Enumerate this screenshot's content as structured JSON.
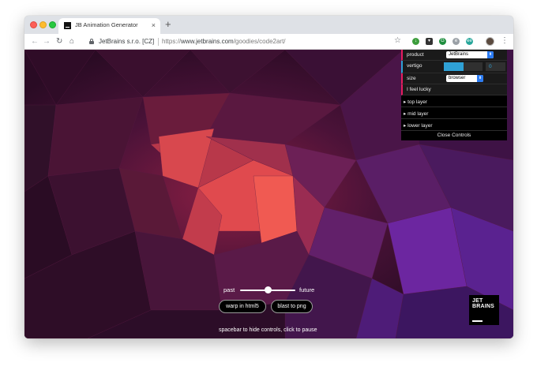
{
  "browser": {
    "tab": {
      "title": "JB Animation Generator",
      "close_glyph": "×",
      "favicon": "jetbrains-favicon-icon"
    },
    "new_tab_glyph": "+",
    "nav": {
      "back": "←",
      "forward": "→",
      "reload": "↻",
      "home": "⌂"
    },
    "address": {
      "ev_label": "JetBrains s.r.o. [CZ]",
      "url_scheme": "https://",
      "url_host": "www.jetbrains.com",
      "url_path": "/goodies/code2art/"
    },
    "star_glyph": "☆",
    "extensions": [
      {
        "icon": "download-extension-icon",
        "glyph": "↓"
      },
      {
        "icon": "pocket-extension-icon",
        "glyph": "▾"
      },
      {
        "icon": "grammarly-extension-icon",
        "glyph": "G"
      },
      {
        "icon": "translate-extension-icon",
        "glyph": "e"
      },
      {
        "icon": "ublock-extension-icon",
        "glyph": "ee"
      }
    ],
    "menu_glyph": "⋮"
  },
  "controls": {
    "product": {
      "label": "product",
      "value": "JetBrains"
    },
    "vertigo": {
      "label": "vertigo",
      "value": "0",
      "fill_fraction": 0.52
    },
    "size": {
      "label": "size",
      "value": "browser"
    },
    "lucky": {
      "label": "I feel lucky"
    },
    "folders": [
      {
        "label": "▸ top layer"
      },
      {
        "label": "▸ mid layer"
      },
      {
        "label": "▸ lower layer"
      }
    ],
    "close_label": "Close Controls",
    "select_arrow": "⬍"
  },
  "timeline": {
    "past_label": "past",
    "future_label": "future",
    "position_fraction": 0.5
  },
  "buttons": {
    "html5": "warp in html5",
    "png": "blast to png"
  },
  "hint": "spacebar to hide controls, click to pause",
  "logo": {
    "line1": "JET",
    "line2": "BRAINS"
  },
  "colors": {
    "accent_pink": "#e61d5f",
    "accent_blue": "#2fa1d6",
    "page_bg": "#2c0d24"
  }
}
